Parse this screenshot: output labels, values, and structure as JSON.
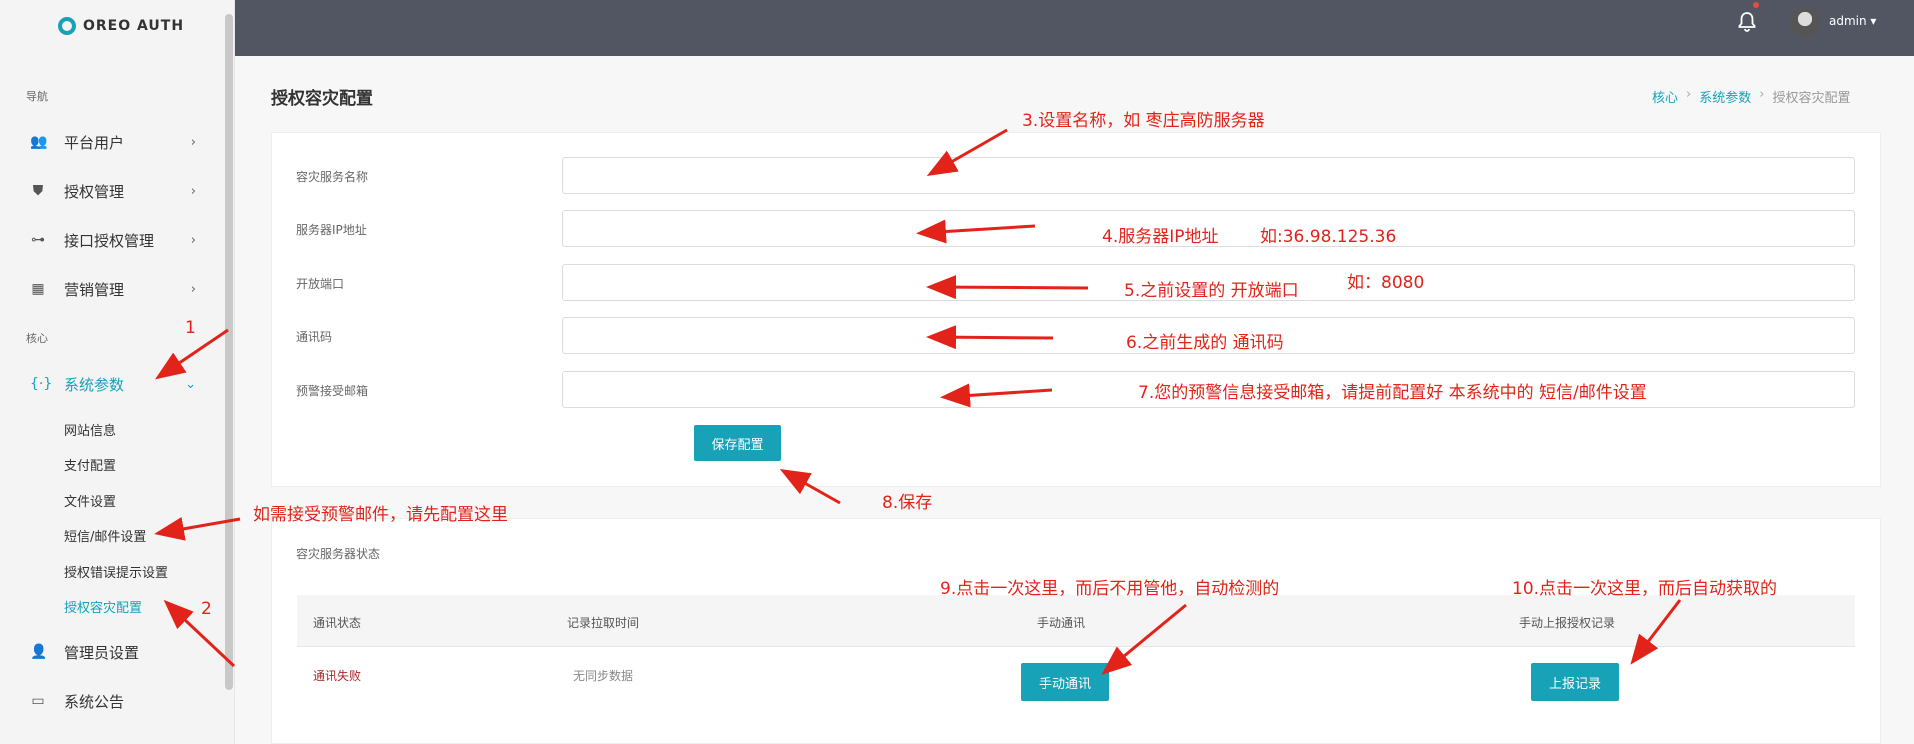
{
  "app": {
    "logo_text": "OREO AUTH"
  },
  "sidebar": {
    "section_nav": "导航",
    "section_core": "核心",
    "items": [
      {
        "label": "平台用户",
        "icon": "users-icon"
      },
      {
        "label": "授权管理",
        "icon": "shield-check-icon"
      },
      {
        "label": "接口授权管理",
        "icon": "api-link-icon"
      },
      {
        "label": "营销管理",
        "icon": "calculator-icon"
      },
      {
        "label": "系统参数",
        "icon": "braces-icon"
      },
      {
        "label": "管理员设置",
        "icon": "user-icon"
      },
      {
        "label": "系统公告",
        "icon": "message-icon"
      }
    ],
    "sub_items": [
      "网站信息",
      "支付配置",
      "文件设置",
      "短信/邮件设置",
      "授权错误提示设置",
      "授权容灾配置"
    ]
  },
  "topbar": {
    "username": "admin ▾"
  },
  "page": {
    "title": "授权容灾配置",
    "breadcrumb": [
      "核心",
      "系统参数",
      "授权容灾配置"
    ]
  },
  "form": {
    "fields": [
      {
        "label": "容灾服务名称",
        "value": ""
      },
      {
        "label": "服务器IP地址",
        "value": ""
      },
      {
        "label": "开放端口",
        "value": ""
      },
      {
        "label": "通讯码",
        "value": ""
      },
      {
        "label": "预警接受邮箱",
        "value": ""
      }
    ],
    "save_label": "保存配置"
  },
  "status": {
    "title": "容灾服务器状态",
    "headers": [
      "通讯状态",
      "记录拉取时间",
      "手动通讯",
      "手动上报授权记录"
    ],
    "row": {
      "state": "通讯失败",
      "pull_time": "无同步数据"
    },
    "manual_button": "手动通讯",
    "report_button": "上报记录"
  },
  "annotations": {
    "a1": "1",
    "a2": "2",
    "a3": "3.设置名称，如 枣庄高防服务器",
    "a4a": "4.服务器IP地址",
    "a4b": "如:36.98.125.36",
    "a5a": "5.之前设置的 开放端口",
    "a5b": "如：8080",
    "a6": "6.之前生成的 通讯码",
    "a7": "7.您的预警信息接受邮箱，请提前配置好 本系统中的 短信/邮件设置",
    "a8": "8.保存",
    "a9": "9.点击一次这里，而后不用管他，自动检测的",
    "a10": "10.点击一次这里，而后自动获取的",
    "amail": "如需接受预警邮件，请先配置这里"
  },
  "colors": {
    "accent": "#17a2b8",
    "topbar": "#525562",
    "annotation": "#e2231a",
    "danger_text": "#a52a2a"
  }
}
